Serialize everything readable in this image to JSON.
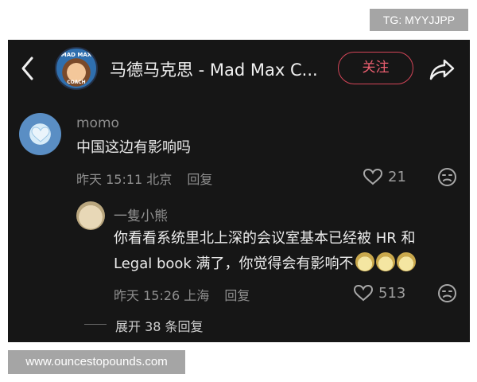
{
  "watermark_top": "TG: MYYJJPP",
  "watermark_bottom": "www.ouncestopounds.com",
  "header": {
    "avatar_text_top": "MAD MAX",
    "avatar_text_bottom": "COACH",
    "title": "马德马克思 - Mad Max C...",
    "follow_label": "关注"
  },
  "comment": {
    "username": "momo",
    "text": "中国这边有影响吗",
    "time": "昨天 15:11",
    "location": "北京",
    "reply_label": "回复",
    "likes": "21"
  },
  "reply": {
    "username": "一隻小熊",
    "text_line1": "你看看系统里北上深的会议室基本已经被 HR 和",
    "text_line2": "Legal book 满了，你觉得会有影响不",
    "time": "昨天 15:26",
    "location": "上海",
    "reply_label": "回复",
    "likes": "513"
  },
  "expand_label": "展开 38 条回复",
  "icons": {
    "back": "chevron-left-icon",
    "share": "share-icon",
    "like": "heart-icon",
    "dislike": "dislike-face-icon"
  },
  "colors": {
    "background": "#161616",
    "follow_accent": "#ec5f70"
  }
}
